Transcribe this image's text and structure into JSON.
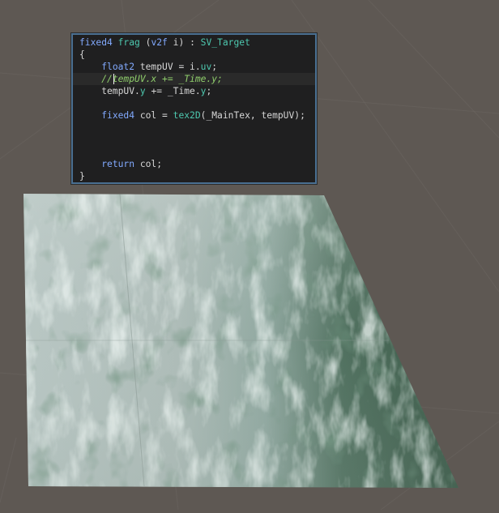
{
  "scene": {
    "background": "#5e5853",
    "grid_color": "#6a6560",
    "texture": "water-foam-texture"
  },
  "code": {
    "lines": [
      {
        "parts": [
          [
            "fixed4",
            "kw"
          ],
          " ",
          [
            "frag",
            "fn"
          ],
          " (",
          [
            "v2f",
            "ty"
          ],
          " i) : ",
          [
            "SV_Target",
            "fn"
          ]
        ]
      },
      {
        "parts": [
          "{"
        ]
      },
      {
        "parts": [
          "    ",
          [
            "float2",
            "kw"
          ],
          " tempUV = i.",
          [
            "uv",
            "fn"
          ],
          ";"
        ]
      },
      {
        "parts": [
          "    ",
          [
            "//tempUV.x += _Time.y;",
            "cm"
          ]
        ],
        "current": true
      },
      {
        "parts": [
          "    tempUV.",
          [
            "y",
            "fn"
          ],
          " += _Time.",
          [
            "y",
            "fn"
          ],
          ";"
        ]
      },
      {
        "parts": [
          ""
        ]
      },
      {
        "parts": [
          "    ",
          [
            "fixed4",
            "kw"
          ],
          " col = ",
          [
            "tex2D",
            "fn"
          ],
          "(_MainTex, tempUV);"
        ]
      },
      {
        "parts": [
          ""
        ]
      },
      {
        "parts": [
          ""
        ]
      },
      {
        "parts": [
          ""
        ]
      },
      {
        "parts": [
          "    ",
          [
            "return",
            "kw"
          ],
          " col;"
        ]
      },
      {
        "parts": [
          "}"
        ]
      }
    ]
  }
}
